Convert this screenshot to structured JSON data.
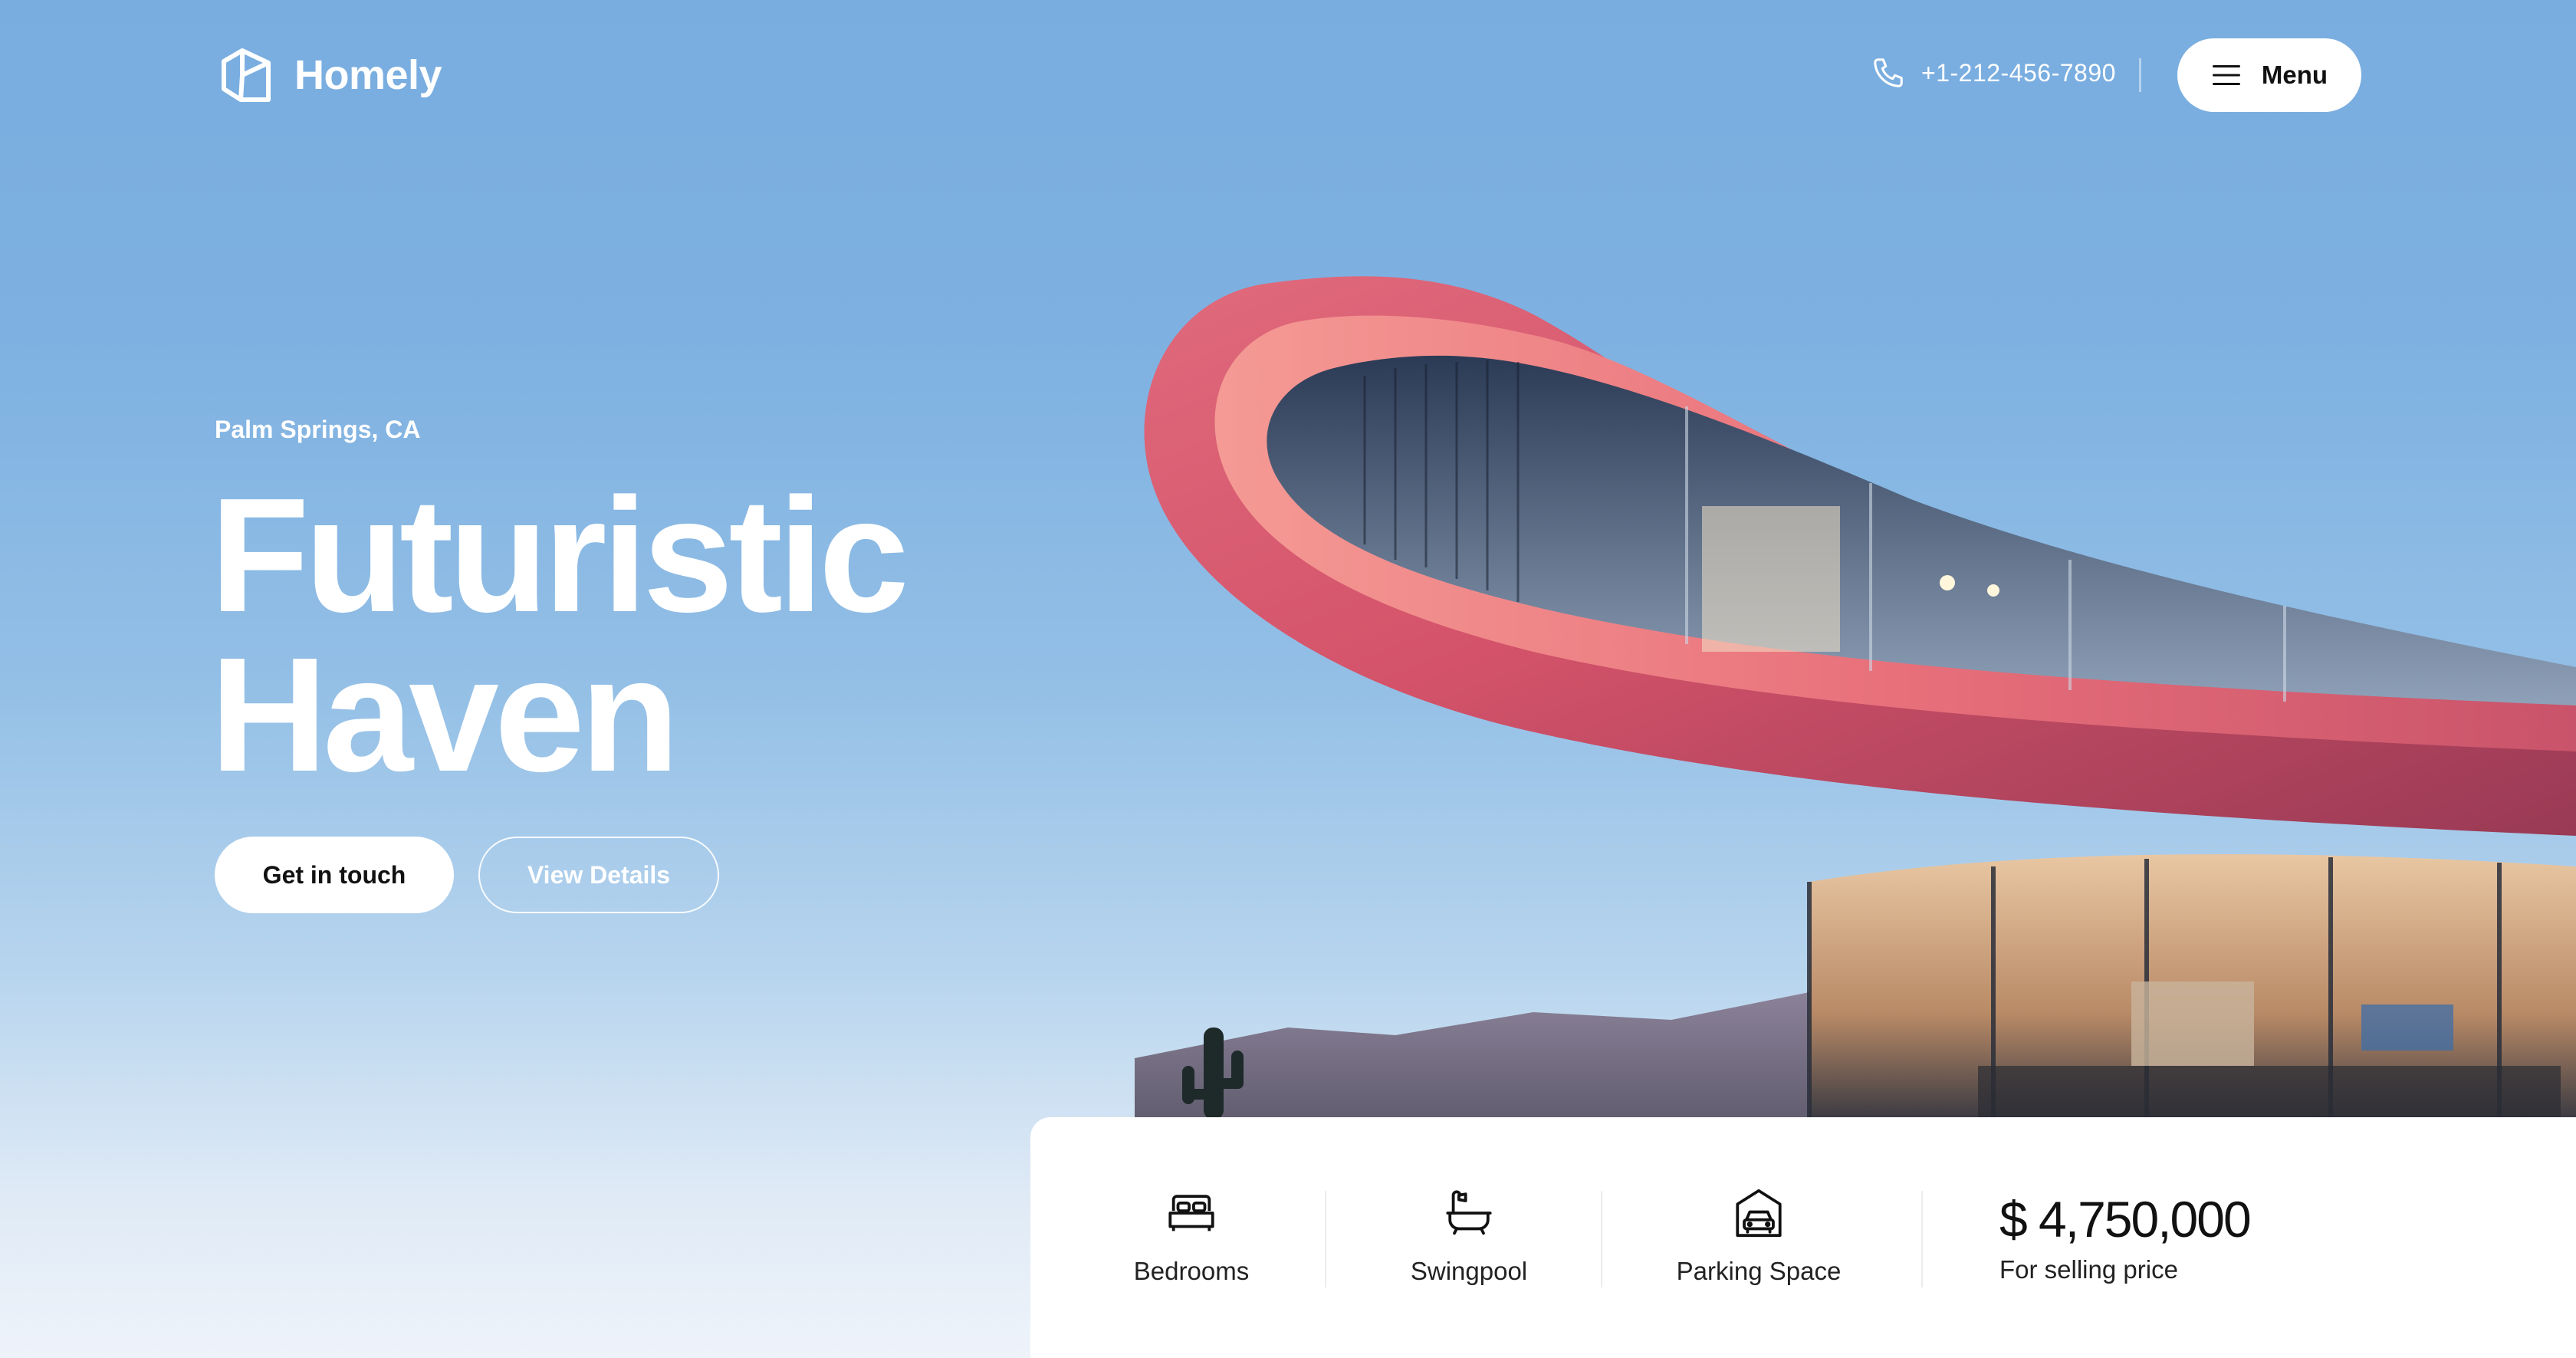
{
  "brand": {
    "name": "Homely"
  },
  "header": {
    "phone": "+1-212-456-7890",
    "menu_label": "Menu"
  },
  "hero": {
    "location": "Palm Springs, CA",
    "title_line1": "Futuristic",
    "title_line2": "Haven",
    "primary_button": "Get in touch",
    "secondary_button": "View Details"
  },
  "stats": {
    "items": [
      {
        "label": "Bedrooms",
        "icon": "bed-icon"
      },
      {
        "label": "Swingpool",
        "icon": "bathtub-icon"
      },
      {
        "label": "Parking Space",
        "icon": "garage-car-icon"
      }
    ],
    "price": "$ 4,750,000",
    "price_label": "For selling price"
  },
  "colors": {
    "sky_top": "#79ade0",
    "sky_bottom": "#eef3fa",
    "accent_roof": "#d9506a",
    "text_dark": "#111111",
    "white": "#ffffff"
  }
}
